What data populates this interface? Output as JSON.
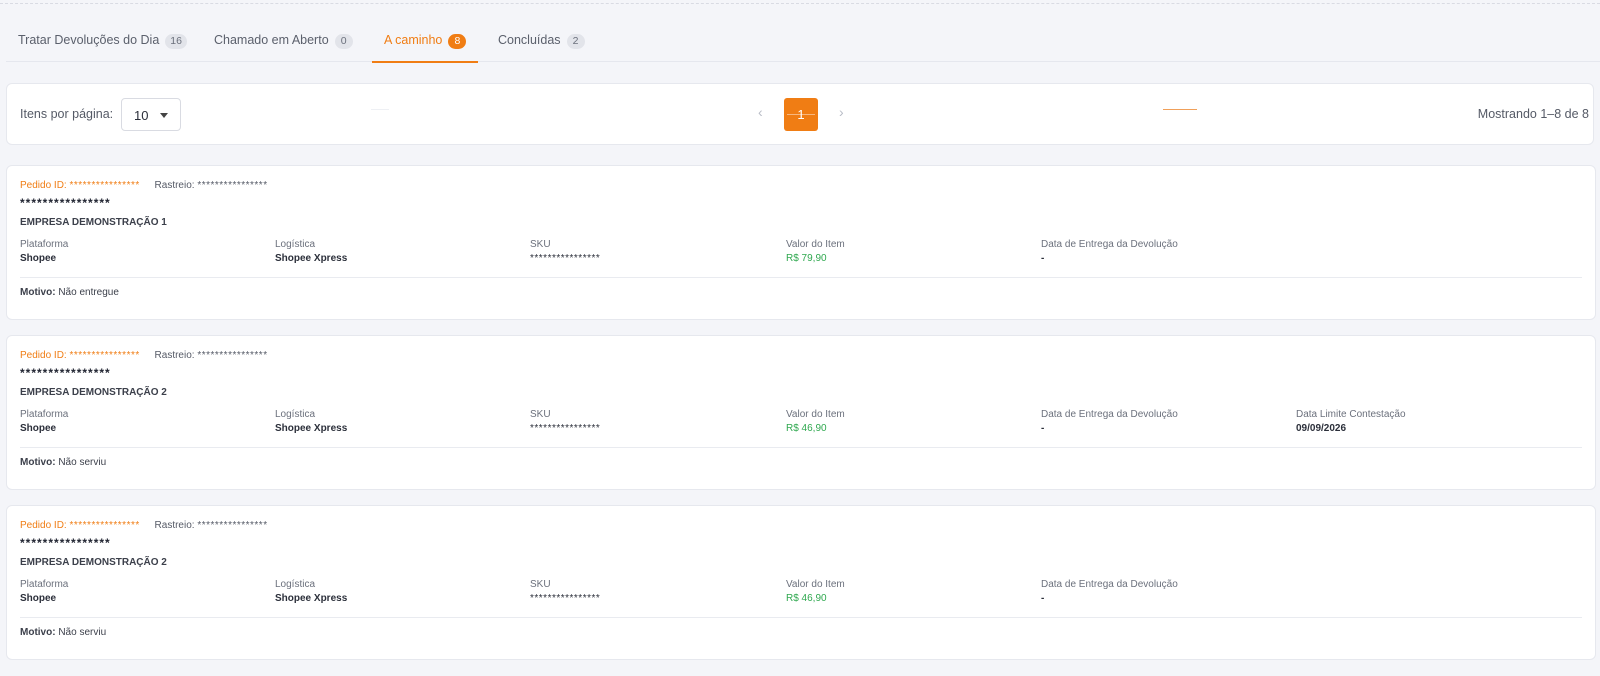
{
  "tabs": [
    {
      "label": "Tratar Devoluções do Dia",
      "count": "16"
    },
    {
      "label": "Chamado em Aberto",
      "count": "0"
    },
    {
      "label": "A caminho",
      "count": "8"
    },
    {
      "label": "Concluídas",
      "count": "2"
    }
  ],
  "pagination": {
    "items_per_page_label": "Itens por página:",
    "items_per_page_value": "10",
    "prev": "‹",
    "current_page": "1",
    "next": "›",
    "showing": "Mostrando 1–8 de 8"
  },
  "field_labels": {
    "pedido_id": "Pedido ID:",
    "rastreio": "Rastreio:",
    "plataforma": "Plataforma",
    "logistica": "Logística",
    "sku": "SKU",
    "valor": "Valor do Item",
    "data_entrega": "Data de Entrega da Devolução",
    "data_limite": "Data Limite Contestação",
    "motivo": "Motivo:"
  },
  "orders": [
    {
      "pedido_id": "****************",
      "rastreio": "****************",
      "masked": "****************",
      "company": "EMPRESA DEMONSTRAÇÃO 1",
      "plataforma": "Shopee",
      "logistica": "Shopee Xpress",
      "sku": "****************",
      "valor": "R$ 79,90",
      "data_entrega": "-",
      "motivo": "Não entregue"
    },
    {
      "pedido_id": "****************",
      "rastreio": "****************",
      "masked": "****************",
      "company": "EMPRESA DEMONSTRAÇÃO 2",
      "plataforma": "Shopee",
      "logistica": "Shopee Xpress",
      "sku": "****************",
      "valor": "R$ 46,90",
      "data_entrega": "-",
      "data_limite": "09/09/2026",
      "motivo": "Não serviu"
    },
    {
      "pedido_id": "****************",
      "rastreio": "****************",
      "masked": "****************",
      "company": "EMPRESA DEMONSTRAÇÃO 2",
      "plataforma": "Shopee",
      "logistica": "Shopee Xpress",
      "sku": "****************",
      "valor": "R$ 46,90",
      "data_entrega": "-",
      "motivo": "Não serviu"
    }
  ]
}
